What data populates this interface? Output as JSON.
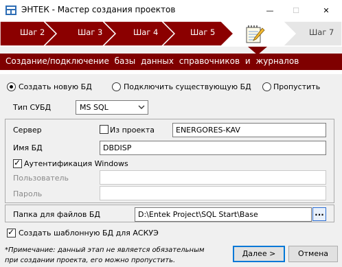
{
  "window": {
    "title": "ЭНТЕК - Мастер создания проектов",
    "minimize_glyph": "—",
    "maximize_glyph": "☐",
    "close_glyph": "✕"
  },
  "steps": {
    "items": [
      "Шаг 2",
      "Шаг 3",
      "Шаг 4",
      "Шаг 5",
      "Шаг 7"
    ],
    "current_icon": "notepad-pencil-icon"
  },
  "banner": {
    "text": "Создание/подключение  базы данных  справочников  и журналов"
  },
  "db_mode": {
    "options": [
      "Создать новую БД",
      "Подключить существующую БД",
      "Пропустить"
    ],
    "selected": 0
  },
  "dbms": {
    "label": "Тип СУБД",
    "value": "MS SQL"
  },
  "server": {
    "label": "Сервер",
    "from_project_label": "Из проекта",
    "from_project_checked": false,
    "value": "ENERGORES-KAV"
  },
  "db_name": {
    "label": "Имя БД",
    "value": "DBDISP"
  },
  "auth": {
    "windows_label": "Аутентификация Windows",
    "windows_checked": true
  },
  "user": {
    "label": "Пользователь",
    "value": ""
  },
  "password": {
    "label": "Пароль",
    "value": ""
  },
  "folder": {
    "label": "Папка для файлов БД",
    "value": "D:\\Entek Project\\SQL Start\\Base",
    "browse_label": "..."
  },
  "template_db": {
    "label": "Создать шаблонную БД для АСКУЭ",
    "checked": true
  },
  "note": {
    "line1": "*Примечание: данный этап не является обязательным",
    "line2": "при создании проекта, его можно пропустить."
  },
  "buttons": {
    "next": "Далее >",
    "cancel": "Отмена"
  },
  "colors": {
    "accent": "#7f0000",
    "step_fill": "#8b0000",
    "step_next": "#e6e6e6"
  }
}
